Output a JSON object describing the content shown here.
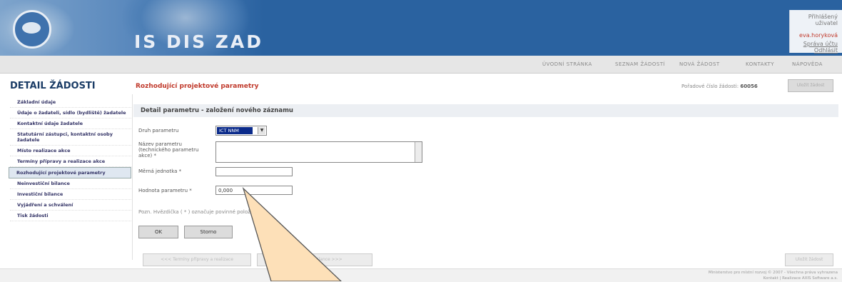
{
  "header": {
    "app_title": "IS DIS ZAD",
    "user_label": "Přihlášený uživatel",
    "user_name": "eva.horyková",
    "account_link": "Správa účtu",
    "logout_link": "Odhlásit"
  },
  "nav": {
    "items": [
      "ÚVODNÍ STRÁNKA",
      "SEZNAM ŽÁDOSTÍ",
      "NOVÁ ŽÁDOST",
      "KONTAKTY",
      "NÁPOVĚDA"
    ]
  },
  "sidebar": {
    "title": "DETAIL ŽÁDOSTI",
    "items": [
      "Základní údaje",
      "Údaje o žadateli, sídlo (bydliště) žadatele",
      "Kontaktní údaje žadatele",
      "Statutární zástupci, kontaktní osoby žadatele",
      "Místo realizace akce",
      "Termíny přípravy a realizace akce",
      "Rozhodující projektové parametry",
      "Neinvestiční bilance",
      "Investiční bilance",
      "Vyjádření a schválení",
      "Tisk žádosti"
    ],
    "active_index": 6
  },
  "main": {
    "section_title": "Rozhodující projektové parametry",
    "request_number_label": "Pořadové číslo žádosti:",
    "request_number": "60056",
    "top_button": "Uložit žádost",
    "panel_title": "Detail parametru - založení nového záznamu",
    "form": {
      "type_label": "Druh parametru",
      "type_value": "ICT NNM",
      "desc_label": "Název parametru (technického parametru akce) *",
      "desc_value": "",
      "unit_label": "Měrná jednotka *",
      "unit_value": "",
      "value_label": "Hodnota parametru *",
      "value_value": "0,000"
    },
    "note": "Pozn. Hvězdička ( * ) označuje povinné položky.",
    "ok_button": "OK",
    "cancel_button": "Storno",
    "bottom_prev": "<<< Termíny přípravy a realizace",
    "bottom_next": "Neinvestiční bilance >>>",
    "bottom_save": "Uložit žádost"
  },
  "footer": {
    "line1": "Ministerstvo pro místní rozvoj © 2007 - Všechna práva vyhrazena",
    "line2": "Kontakt | Realizace AXIS Software a.s."
  },
  "colors": {
    "header_bg": "#2a62a0",
    "accent_red": "#c0392b",
    "title_blue": "#1a3c66",
    "callout_fill": "#fde0b8"
  }
}
